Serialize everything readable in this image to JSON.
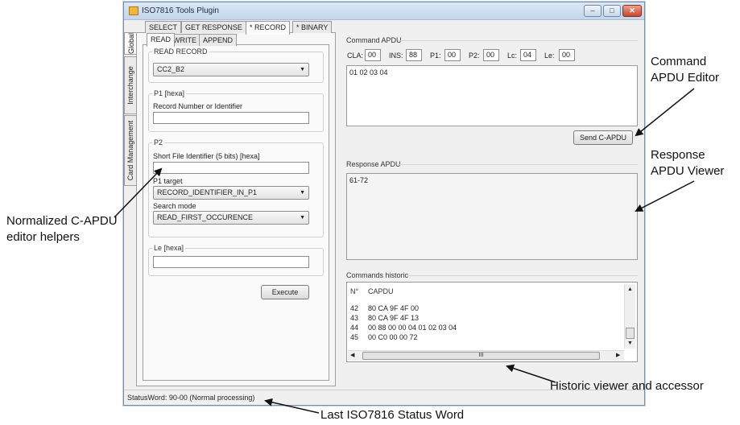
{
  "window": {
    "title": "ISO7816 Tools Plugin",
    "controls": {
      "minimize": "–",
      "maximize": "□",
      "close": "✕"
    }
  },
  "side_tabs": [
    "Global",
    "Interchange",
    "Card Management"
  ],
  "command_tabs": [
    "SELECT",
    "GET RESPONSE",
    "* RECORD",
    "* BINARY"
  ],
  "record_tabs": [
    "READ",
    "WRITE",
    "APPEND"
  ],
  "read_record": {
    "group_label": "READ RECORD",
    "selected": "CC2_B2"
  },
  "p1": {
    "group_label": "P1 [hexa]",
    "field_label": "Record Number or Identifier",
    "value": ""
  },
  "p2": {
    "group_label": "P2",
    "sfi_label": "Short File Identifier (5 bits) [hexa]",
    "sfi_value": "",
    "p1_target_label": "P1 target",
    "p1_target_value": "RECORD_IDENTIFIER_IN_P1",
    "search_mode_label": "Search mode",
    "search_mode_value": "READ_FIRST_OCCURENCE"
  },
  "le": {
    "group_label": "Le [hexa]",
    "value": ""
  },
  "execute_label": "Execute",
  "command_apdu": {
    "title": "Command APDU",
    "fields": [
      {
        "label": "CLA:",
        "value": "00"
      },
      {
        "label": "INS:",
        "value": "88"
      },
      {
        "label": "P1:",
        "value": "00"
      },
      {
        "label": "P2:",
        "value": "00"
      },
      {
        "label": "Lc:",
        "value": "04"
      },
      {
        "label": "Le:",
        "value": "00"
      }
    ],
    "data": "01 02 03 04",
    "send_label": "Send C-APDU"
  },
  "response_apdu": {
    "title": "Response APDU",
    "data": "61-72"
  },
  "history": {
    "title": "Commands historic",
    "columns": [
      "N°",
      "CAPDU"
    ],
    "rows": [
      {
        "n": "42",
        "capdu": "80 CA 9F 4F 00"
      },
      {
        "n": "43",
        "capdu": "80 CA 9F 4F 13"
      },
      {
        "n": "44",
        "capdu": "00 88 00 00 04 01 02 03 04"
      },
      {
        "n": "45",
        "capdu": "00 C0 00 00 72"
      }
    ],
    "scroll_grip": "III"
  },
  "status": {
    "text": "StatusWord: 90-00 (Normal processing)"
  },
  "annotations": {
    "command_editor": [
      "Command",
      "APDU Editor"
    ],
    "response_viewer": [
      "Response",
      "APDU Viewer"
    ],
    "helpers": [
      "Normalized C-APDU",
      "editor helpers"
    ],
    "historic": "Historic viewer and accessor",
    "status_word": "Last ISO7816 Status Word"
  }
}
